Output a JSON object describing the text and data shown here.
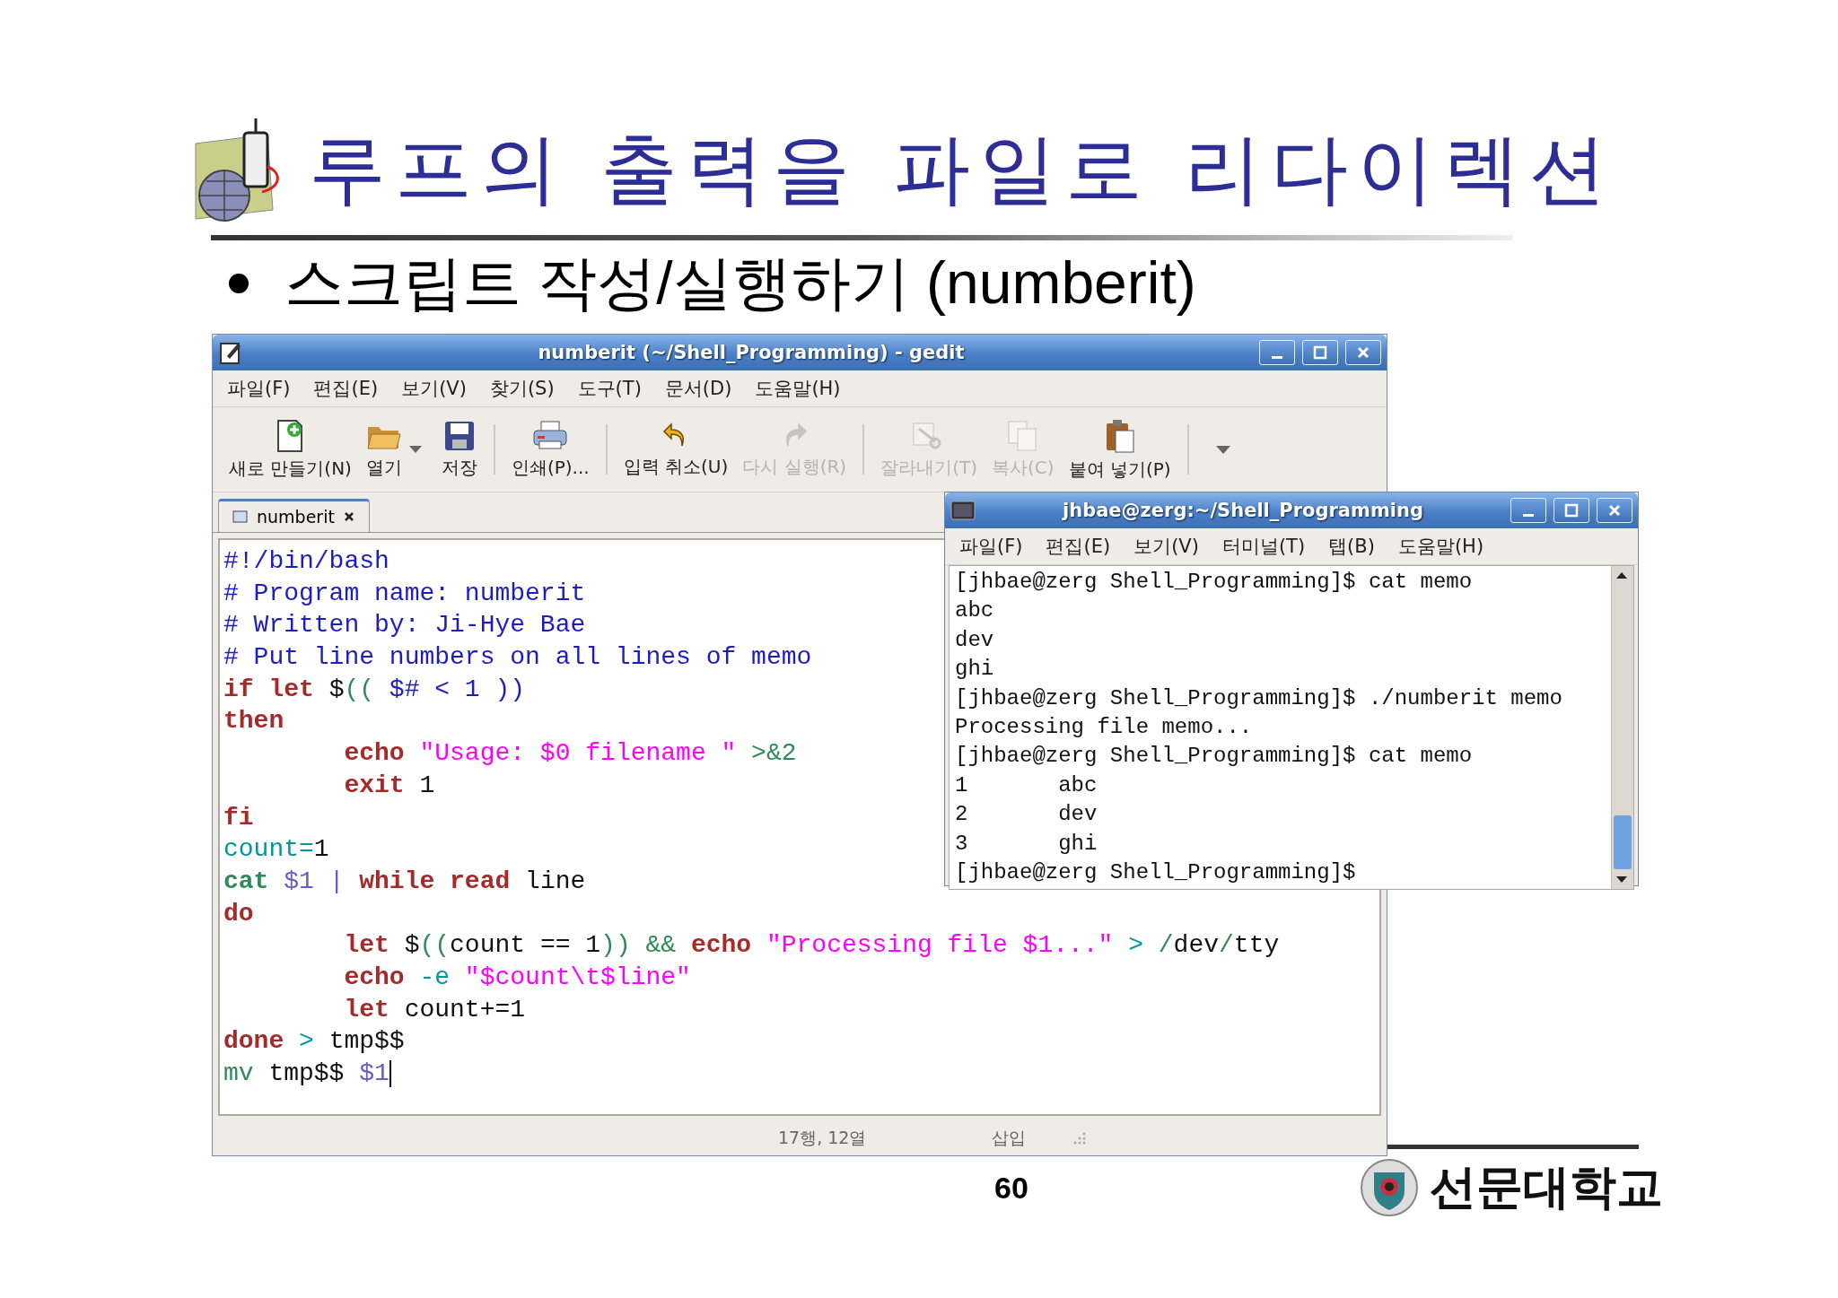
{
  "slide": {
    "title": "루프의 출력을 파일로 리다이렉션",
    "bullet": "스크립트 작성/실행하기 (numberit)",
    "page_number": "60",
    "university": "선문대학교"
  },
  "gedit": {
    "title": "numberit (~/Shell_Programming) - gedit",
    "menu": [
      "파일(F)",
      "편집(E)",
      "보기(V)",
      "찾기(S)",
      "도구(T)",
      "문서(D)",
      "도움말(H)"
    ],
    "toolbar": [
      [
        {
          "kind": "new",
          "label": "새로 만들기(N)",
          "disabled": false
        },
        {
          "kind": "open",
          "label": "열기",
          "disabled": false
        },
        {
          "kind": "save",
          "label": "저장",
          "disabled": false
        }
      ],
      [
        {
          "kind": "print",
          "label": "인쇄(P)...",
          "disabled": false
        }
      ],
      [
        {
          "kind": "undo",
          "label": "입력 취소(U)",
          "disabled": false
        },
        {
          "kind": "redo",
          "label": "다시 실행(R)",
          "disabled": true
        }
      ],
      [
        {
          "kind": "cut",
          "label": "잘라내기(T)",
          "disabled": true
        },
        {
          "kind": "copy",
          "label": "복사(C)",
          "disabled": true
        },
        {
          "kind": "paste",
          "label": "붙여 넣기(P)",
          "disabled": false
        }
      ]
    ],
    "tabs": [
      {
        "label": "numberit",
        "selected": true
      }
    ],
    "code": [
      {
        "cursor": false,
        "tokens": [
          {
            "kind": "comment",
            "text": "#!/bin/bash"
          }
        ]
      },
      {
        "cursor": false,
        "tokens": [
          {
            "kind": "comment",
            "text": "# Program name: numberit"
          }
        ]
      },
      {
        "cursor": false,
        "tokens": [
          {
            "kind": "comment",
            "text": "# Written by: Ji-Hye Bae"
          }
        ]
      },
      {
        "cursor": false,
        "tokens": [
          {
            "kind": "comment",
            "text": "# Put line numbers on all lines of memo"
          }
        ]
      },
      {
        "cursor": false,
        "tokens": [
          {
            "kind": "keyword",
            "text": "if let"
          },
          {
            "kind": "plain",
            "text": " $"
          },
          {
            "kind": "paren",
            "text": "(("
          },
          {
            "kind": "comment",
            "text": " $# < 1 ))"
          }
        ]
      },
      {
        "cursor": false,
        "tokens": [
          {
            "kind": "keyword",
            "text": "then"
          }
        ]
      },
      {
        "cursor": false,
        "tokens": [
          {
            "kind": "keyword",
            "text": "\techo"
          },
          {
            "kind": "string",
            "text": " \"Usage: $0 filename \""
          },
          {
            "kind": "paren",
            "text": " >&2"
          }
        ]
      },
      {
        "cursor": false,
        "tokens": [
          {
            "kind": "keyword",
            "text": "\texit"
          },
          {
            "kind": "plain",
            "text": " 1"
          }
        ]
      },
      {
        "cursor": false,
        "tokens": [
          {
            "kind": "keyword",
            "text": "fi"
          }
        ]
      },
      {
        "cursor": false,
        "tokens": [
          {
            "kind": "operator",
            "text": "count="
          },
          {
            "kind": "plain",
            "text": "1"
          }
        ]
      },
      {
        "cursor": false,
        "tokens": [
          {
            "kind": "builtin",
            "text": "cat"
          },
          {
            "kind": "variable",
            "text": " $1 | "
          },
          {
            "kind": "keyword",
            "text": "while read"
          },
          {
            "kind": "plain",
            "text": " line"
          }
        ]
      },
      {
        "cursor": false,
        "tokens": [
          {
            "kind": "keyword",
            "text": "do"
          }
        ]
      },
      {
        "cursor": false,
        "tokens": [
          {
            "kind": "keyword",
            "text": "\tlet"
          },
          {
            "kind": "plain",
            "text": " $"
          },
          {
            "kind": "paren",
            "text": "(("
          },
          {
            "kind": "plain",
            "text": "count == 1"
          },
          {
            "kind": "paren",
            "text": ")) &&"
          },
          {
            "kind": "keyword",
            "text": " echo"
          },
          {
            "kind": "string",
            "text": " \"Processing file $1...\""
          },
          {
            "kind": "operator",
            "text": " >"
          },
          {
            "kind": "paren",
            "text": " /"
          },
          {
            "kind": "plain",
            "text": "dev"
          },
          {
            "kind": "paren",
            "text": "/"
          },
          {
            "kind": "plain",
            "text": "tty"
          }
        ]
      },
      {
        "cursor": false,
        "tokens": [
          {
            "kind": "keyword",
            "text": "\techo"
          },
          {
            "kind": "operator",
            "text": " -e"
          },
          {
            "kind": "string",
            "text": " \"$count\\t$line\""
          }
        ]
      },
      {
        "cursor": false,
        "tokens": [
          {
            "kind": "keyword",
            "text": "\tlet"
          },
          {
            "kind": "plain",
            "text": " count+=1"
          }
        ]
      },
      {
        "cursor": false,
        "tokens": [
          {
            "kind": "keyword",
            "text": "done"
          },
          {
            "kind": "operator",
            "text": " >"
          },
          {
            "kind": "plain",
            "text": " tmp$$"
          }
        ]
      },
      {
        "cursor": true,
        "tokens": [
          {
            "kind": "mv",
            "text": "mv"
          },
          {
            "kind": "plain",
            "text": " tmp$$"
          },
          {
            "kind": "variable",
            "text": " $1"
          }
        ]
      }
    ],
    "status": {
      "position": "17행, 12열",
      "mode": "삽입"
    }
  },
  "terminal": {
    "title": "jhbae@zerg:~/Shell_Programming",
    "menu": [
      "파일(F)",
      "편집(E)",
      "보기(V)",
      "터미널(T)",
      "탭(B)",
      "도움말(H)"
    ],
    "lines": [
      "[jhbae@zerg Shell_Programming]$ cat memo",
      "abc",
      "dev",
      "ghi",
      "[jhbae@zerg Shell_Programming]$ ./numberit memo",
      "Processing file memo...",
      "[jhbae@zerg Shell_Programming]$ cat memo",
      "1\tabc",
      "2\tdev",
      "3\tghi",
      "[jhbae@zerg Shell_Programming]$"
    ]
  }
}
